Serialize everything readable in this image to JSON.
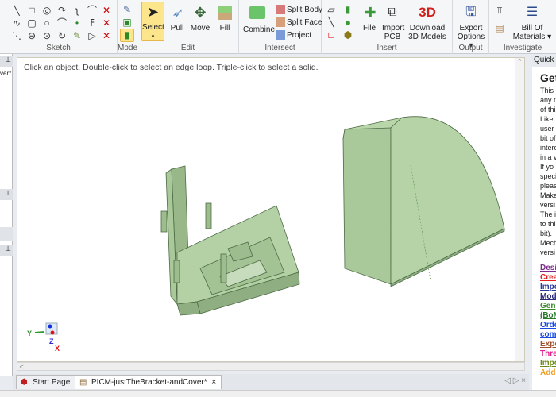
{
  "ribbon": {
    "groups": {
      "sketch": "Sketch",
      "mode": "Mode",
      "edit": "Edit",
      "intersect": "Intersect",
      "insert": "Insert",
      "output": "Output",
      "investigate": "Investigate"
    },
    "edit": {
      "select": "Select",
      "pull": "Pull",
      "move": "Move",
      "fill": "Fill"
    },
    "intersect": {
      "combine": "Combine",
      "split_body": "Split Body",
      "split_face": "Split Face",
      "project": "Project"
    },
    "insert": {
      "file": "File",
      "import_pcb": "Import PCB",
      "download": "Download 3D Models",
      "download_logo": "3D"
    },
    "output": {
      "export": "Export Options"
    },
    "investigate": {
      "bom": "Bill Of Materials"
    }
  },
  "left_panel": {
    "title_fragment": "ver*"
  },
  "viewport": {
    "hint": "Click an object. Double-click to select an edge loop. Triple-click to select a solid.",
    "model_color": "#a9c99a",
    "axes": {
      "x": "X",
      "y": "Y",
      "z": "Z"
    }
  },
  "tabs": [
    {
      "label": "Start Page"
    },
    {
      "label": "PICM-justTheBracket-andCover*"
    }
  ],
  "quick_panel": {
    "title": "Quick G",
    "heading": "Get",
    "lines": [
      "This",
      "any t",
      "of thi",
      "Like",
      "user",
      "bit of",
      "intere",
      "in a v",
      "If yo",
      "speci",
      "pleas",
      "Make",
      "versi",
      "The i",
      "to thi",
      "bit).",
      "Mech",
      "versi"
    ],
    "links": [
      {
        "text": "Desi",
        "color": "#7b2a8a"
      },
      {
        "text": "Crea",
        "color": "#e0201c"
      },
      {
        "text": "Impo",
        "color": "#2a3a9a"
      },
      {
        "text": "Mod",
        "color": "#2a2a7a"
      },
      {
        "text": "Gen",
        "color": "#3a8a2a"
      },
      {
        "text": "(BoM",
        "color": "#2a7a2a"
      },
      {
        "text": "Orde",
        "color": "#1a4ae0"
      },
      {
        "text": "com",
        "color": "#1a4ae0"
      },
      {
        "text": "Expo",
        "color": "#a0522d"
      },
      {
        "text": "Thre",
        "color": "#e0208a"
      },
      {
        "text": "Impo",
        "color": "#6a8a1a"
      },
      {
        "text": "Addi",
        "color": "#f0a020"
      }
    ]
  }
}
